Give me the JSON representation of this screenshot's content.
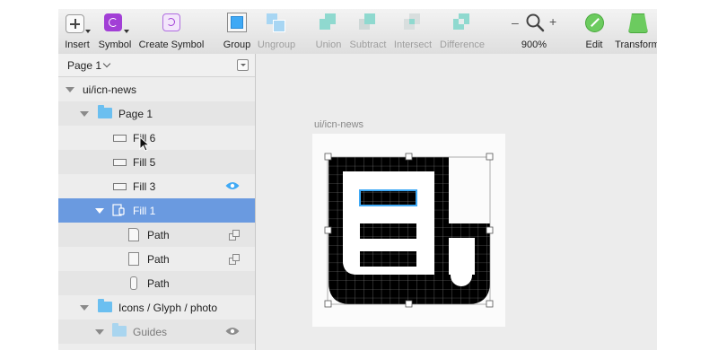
{
  "toolbar": {
    "insert": "Insert",
    "symbol": "Symbol",
    "create_symbol": "Create Symbol",
    "group": "Group",
    "ungroup": "Ungroup",
    "union": "Union",
    "subtract": "Subtract",
    "intersect": "Intersect",
    "difference": "Difference",
    "zoom_minus": "–",
    "zoom_plus": "+",
    "zoom_value": "900%",
    "edit": "Edit",
    "transform": "Transform"
  },
  "page_selector": {
    "label": "Page 1"
  },
  "layers": [
    {
      "name": "ui/icn-news",
      "type": "artboard",
      "expanded": true
    },
    {
      "name": "Page 1",
      "type": "folder",
      "expanded": true
    },
    {
      "name": "Fill 6",
      "type": "rectangle"
    },
    {
      "name": "Fill 5",
      "type": "rectangle"
    },
    {
      "name": "Fill 3",
      "type": "rectangle",
      "visibility_icon": "eye-icon"
    },
    {
      "name": "Fill 1",
      "type": "group",
      "expanded": true,
      "selected": true
    },
    {
      "name": "Path",
      "type": "path",
      "mask_icon": "mask-icon"
    },
    {
      "name": "Path",
      "type": "path",
      "mask_icon": "mask-icon"
    },
    {
      "name": "Path",
      "type": "path"
    },
    {
      "name": "Icons / Glyph / photo",
      "type": "folder",
      "expanded": true
    },
    {
      "name": "Guides",
      "type": "folder",
      "expanded": true,
      "dimmed": true,
      "visibility_icon": "eye-icon"
    }
  ],
  "canvas": {
    "artboard_label": "ui/icn-news"
  },
  "colors": {
    "selection": "#6a9ae0",
    "folder": "#6bbff0",
    "accent_blue": "#3fa9f5",
    "boolean_ops": "#4fc4b6",
    "edit_green": "#5ec254"
  }
}
